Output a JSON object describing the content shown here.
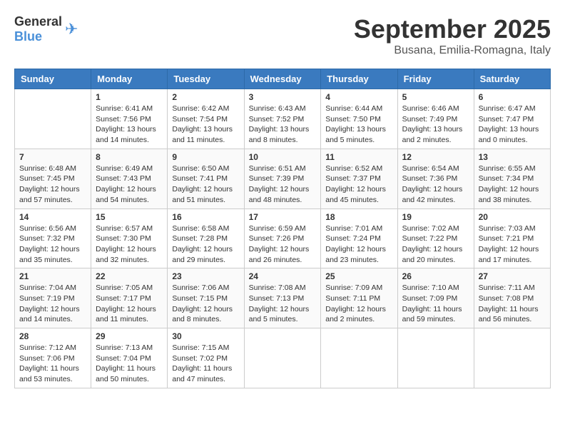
{
  "logo": {
    "general": "General",
    "blue": "Blue"
  },
  "header": {
    "month": "September 2025",
    "location": "Busana, Emilia-Romagna, Italy"
  },
  "weekdays": [
    "Sunday",
    "Monday",
    "Tuesday",
    "Wednesday",
    "Thursday",
    "Friday",
    "Saturday"
  ],
  "weeks": [
    [
      {
        "day": "",
        "sunrise": "",
        "sunset": "",
        "daylight": ""
      },
      {
        "day": "1",
        "sunrise": "Sunrise: 6:41 AM",
        "sunset": "Sunset: 7:56 PM",
        "daylight": "Daylight: 13 hours and 14 minutes."
      },
      {
        "day": "2",
        "sunrise": "Sunrise: 6:42 AM",
        "sunset": "Sunset: 7:54 PM",
        "daylight": "Daylight: 13 hours and 11 minutes."
      },
      {
        "day": "3",
        "sunrise": "Sunrise: 6:43 AM",
        "sunset": "Sunset: 7:52 PM",
        "daylight": "Daylight: 13 hours and 8 minutes."
      },
      {
        "day": "4",
        "sunrise": "Sunrise: 6:44 AM",
        "sunset": "Sunset: 7:50 PM",
        "daylight": "Daylight: 13 hours and 5 minutes."
      },
      {
        "day": "5",
        "sunrise": "Sunrise: 6:46 AM",
        "sunset": "Sunset: 7:49 PM",
        "daylight": "Daylight: 13 hours and 2 minutes."
      },
      {
        "day": "6",
        "sunrise": "Sunrise: 6:47 AM",
        "sunset": "Sunset: 7:47 PM",
        "daylight": "Daylight: 13 hours and 0 minutes."
      }
    ],
    [
      {
        "day": "7",
        "sunrise": "Sunrise: 6:48 AM",
        "sunset": "Sunset: 7:45 PM",
        "daylight": "Daylight: 12 hours and 57 minutes."
      },
      {
        "day": "8",
        "sunrise": "Sunrise: 6:49 AM",
        "sunset": "Sunset: 7:43 PM",
        "daylight": "Daylight: 12 hours and 54 minutes."
      },
      {
        "day": "9",
        "sunrise": "Sunrise: 6:50 AM",
        "sunset": "Sunset: 7:41 PM",
        "daylight": "Daylight: 12 hours and 51 minutes."
      },
      {
        "day": "10",
        "sunrise": "Sunrise: 6:51 AM",
        "sunset": "Sunset: 7:39 PM",
        "daylight": "Daylight: 12 hours and 48 minutes."
      },
      {
        "day": "11",
        "sunrise": "Sunrise: 6:52 AM",
        "sunset": "Sunset: 7:37 PM",
        "daylight": "Daylight: 12 hours and 45 minutes."
      },
      {
        "day": "12",
        "sunrise": "Sunrise: 6:54 AM",
        "sunset": "Sunset: 7:36 PM",
        "daylight": "Daylight: 12 hours and 42 minutes."
      },
      {
        "day": "13",
        "sunrise": "Sunrise: 6:55 AM",
        "sunset": "Sunset: 7:34 PM",
        "daylight": "Daylight: 12 hours and 38 minutes."
      }
    ],
    [
      {
        "day": "14",
        "sunrise": "Sunrise: 6:56 AM",
        "sunset": "Sunset: 7:32 PM",
        "daylight": "Daylight: 12 hours and 35 minutes."
      },
      {
        "day": "15",
        "sunrise": "Sunrise: 6:57 AM",
        "sunset": "Sunset: 7:30 PM",
        "daylight": "Daylight: 12 hours and 32 minutes."
      },
      {
        "day": "16",
        "sunrise": "Sunrise: 6:58 AM",
        "sunset": "Sunset: 7:28 PM",
        "daylight": "Daylight: 12 hours and 29 minutes."
      },
      {
        "day": "17",
        "sunrise": "Sunrise: 6:59 AM",
        "sunset": "Sunset: 7:26 PM",
        "daylight": "Daylight: 12 hours and 26 minutes."
      },
      {
        "day": "18",
        "sunrise": "Sunrise: 7:01 AM",
        "sunset": "Sunset: 7:24 PM",
        "daylight": "Daylight: 12 hours and 23 minutes."
      },
      {
        "day": "19",
        "sunrise": "Sunrise: 7:02 AM",
        "sunset": "Sunset: 7:22 PM",
        "daylight": "Daylight: 12 hours and 20 minutes."
      },
      {
        "day": "20",
        "sunrise": "Sunrise: 7:03 AM",
        "sunset": "Sunset: 7:21 PM",
        "daylight": "Daylight: 12 hours and 17 minutes."
      }
    ],
    [
      {
        "day": "21",
        "sunrise": "Sunrise: 7:04 AM",
        "sunset": "Sunset: 7:19 PM",
        "daylight": "Daylight: 12 hours and 14 minutes."
      },
      {
        "day": "22",
        "sunrise": "Sunrise: 7:05 AM",
        "sunset": "Sunset: 7:17 PM",
        "daylight": "Daylight: 12 hours and 11 minutes."
      },
      {
        "day": "23",
        "sunrise": "Sunrise: 7:06 AM",
        "sunset": "Sunset: 7:15 PM",
        "daylight": "Daylight: 12 hours and 8 minutes."
      },
      {
        "day": "24",
        "sunrise": "Sunrise: 7:08 AM",
        "sunset": "Sunset: 7:13 PM",
        "daylight": "Daylight: 12 hours and 5 minutes."
      },
      {
        "day": "25",
        "sunrise": "Sunrise: 7:09 AM",
        "sunset": "Sunset: 7:11 PM",
        "daylight": "Daylight: 12 hours and 2 minutes."
      },
      {
        "day": "26",
        "sunrise": "Sunrise: 7:10 AM",
        "sunset": "Sunset: 7:09 PM",
        "daylight": "Daylight: 11 hours and 59 minutes."
      },
      {
        "day": "27",
        "sunrise": "Sunrise: 7:11 AM",
        "sunset": "Sunset: 7:08 PM",
        "daylight": "Daylight: 11 hours and 56 minutes."
      }
    ],
    [
      {
        "day": "28",
        "sunrise": "Sunrise: 7:12 AM",
        "sunset": "Sunset: 7:06 PM",
        "daylight": "Daylight: 11 hours and 53 minutes."
      },
      {
        "day": "29",
        "sunrise": "Sunrise: 7:13 AM",
        "sunset": "Sunset: 7:04 PM",
        "daylight": "Daylight: 11 hours and 50 minutes."
      },
      {
        "day": "30",
        "sunrise": "Sunrise: 7:15 AM",
        "sunset": "Sunset: 7:02 PM",
        "daylight": "Daylight: 11 hours and 47 minutes."
      },
      {
        "day": "",
        "sunrise": "",
        "sunset": "",
        "daylight": ""
      },
      {
        "day": "",
        "sunrise": "",
        "sunset": "",
        "daylight": ""
      },
      {
        "day": "",
        "sunrise": "",
        "sunset": "",
        "daylight": ""
      },
      {
        "day": "",
        "sunrise": "",
        "sunset": "",
        "daylight": ""
      }
    ]
  ]
}
